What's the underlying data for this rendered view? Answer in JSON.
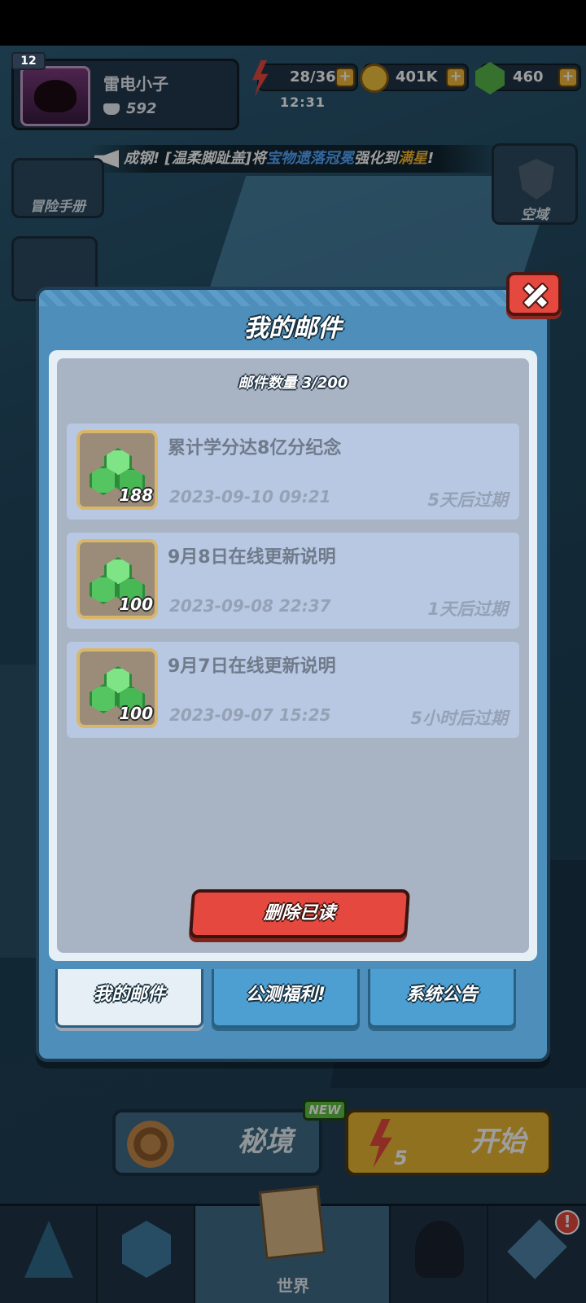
{
  "hud": {
    "level": "12",
    "player_name": "雷电小子",
    "power": "592",
    "energy": "28/36",
    "gold": "401K",
    "gems": "460",
    "timer": "12:31"
  },
  "broadcast": {
    "prefix": "成钢! [",
    "player": "温柔脚趾盖",
    "mid": "]将",
    "item": "宝物遗落冠冕",
    "mid2": "强化到",
    "level": "满星",
    "suffix": "!"
  },
  "side": {
    "handbook_label": "冒险手册",
    "airspace_label": "空域"
  },
  "dialog": {
    "title": "我的邮件",
    "mail_count": "邮件数量 3/200",
    "mails": [
      {
        "title": "累计学分达8亿分纪念",
        "quantity": "188",
        "date": "2023-09-10 09:21",
        "expire": "5天后过期"
      },
      {
        "title": "9月8日在线更新说明",
        "quantity": "100",
        "date": "2023-09-08 22:37",
        "expire": "1天后过期"
      },
      {
        "title": "9月7日在线更新说明",
        "quantity": "100",
        "date": "2023-09-07 15:25",
        "expire": "5小时后过期"
      }
    ],
    "delete_read_label": "删除已读",
    "tabs": [
      {
        "label": "我的邮件",
        "active": true
      },
      {
        "label": "公测福利!",
        "active": false
      },
      {
        "label": "系统公告",
        "active": false
      }
    ]
  },
  "bottom": {
    "mystic_label": "秘境",
    "new_badge": "NEW",
    "start_label": "开始",
    "start_cost": "5",
    "world_label": "世界",
    "alert": "!"
  }
}
